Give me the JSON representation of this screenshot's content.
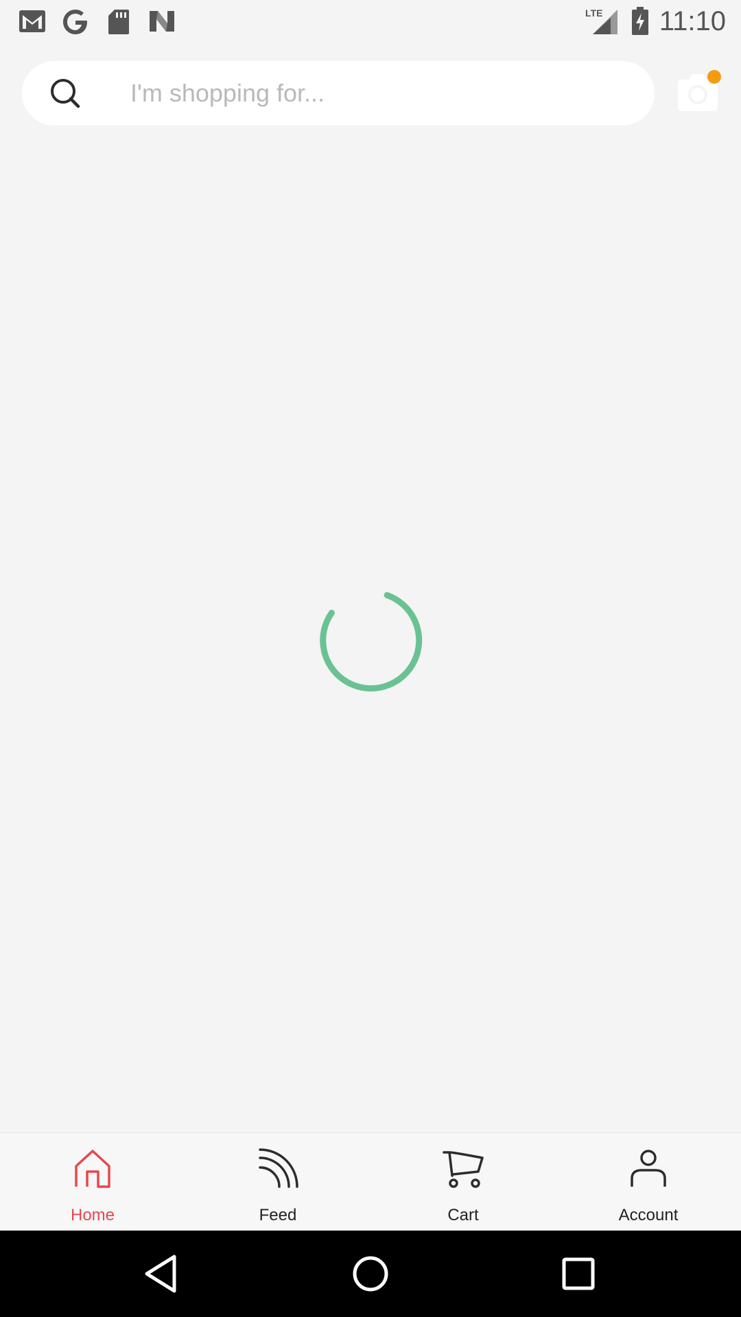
{
  "status_bar": {
    "time": "11:10",
    "network": "LTE",
    "left_icons": [
      "gmail-icon",
      "google-icon",
      "sd-card-icon",
      "n-icon"
    ],
    "right_icons": [
      "lte-signal-icon",
      "battery-charging-icon"
    ]
  },
  "search": {
    "placeholder": "I'm shopping for..."
  },
  "camera": {
    "icon": "camera-icon",
    "badge_color": "#f39c12"
  },
  "loading": {
    "spinner_color": "#6ac293"
  },
  "bottom_nav": {
    "items": [
      {
        "label": "Home",
        "icon": "home-icon",
        "active": true
      },
      {
        "label": "Feed",
        "icon": "feed-icon",
        "active": false
      },
      {
        "label": "Cart",
        "icon": "cart-icon",
        "active": false
      },
      {
        "label": "Account",
        "icon": "account-icon",
        "active": false
      }
    ],
    "active_color": "#e8474d",
    "inactive_color": "#222222"
  },
  "system_nav": {
    "buttons": [
      "back-icon",
      "home-circle-icon",
      "recents-icon"
    ]
  }
}
